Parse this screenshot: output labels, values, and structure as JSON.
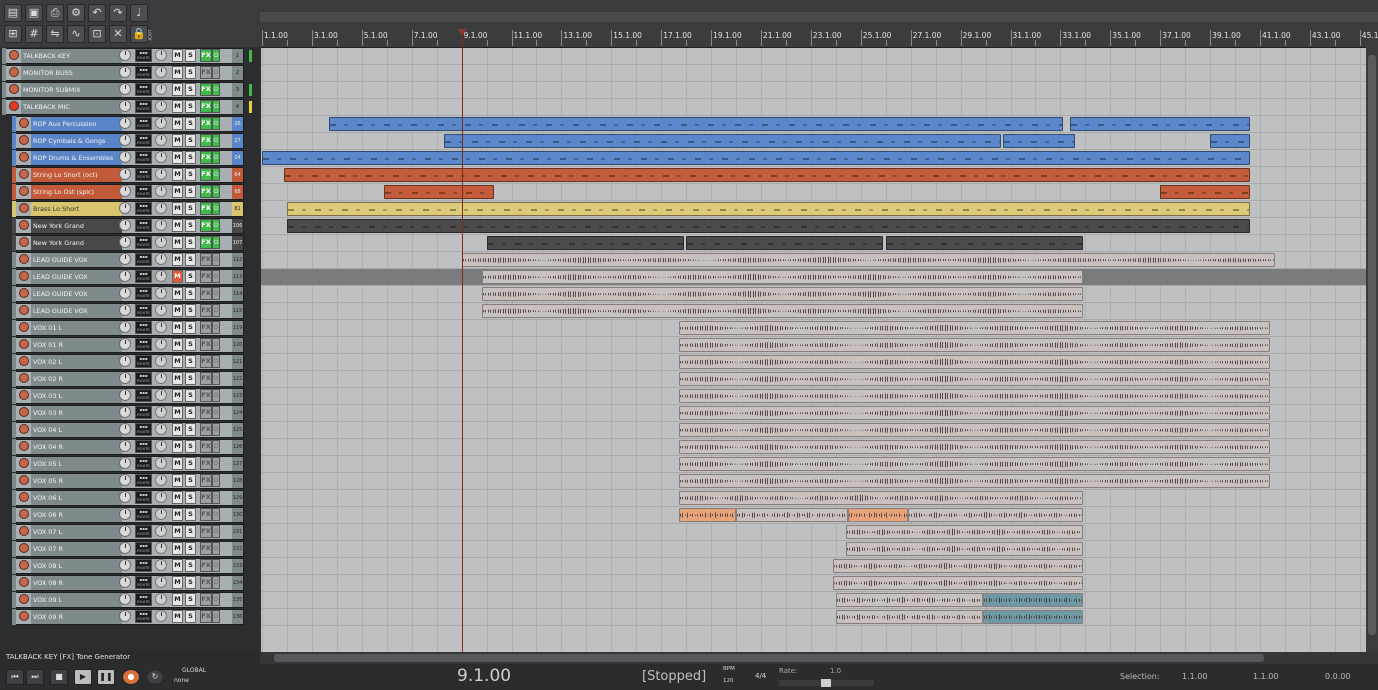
{
  "toolbar": {
    "icons": [
      "new-project-icon",
      "open-project-icon",
      "save-project-icon",
      "project-settings-icon",
      "undo-icon",
      "redo-icon",
      "metronome-icon",
      "snap-icon",
      "grid-icon",
      "ripple-edit-icon",
      "envelope-icon",
      "item-lock-icon",
      "auto-crossfade-icon",
      "lock-icon"
    ],
    "lock_label": "LOCK"
  },
  "tracks": [
    {
      "name": "TALKBACK KEY",
      "num": "1",
      "color": "#7f8a8d",
      "fx": true,
      "muted": false,
      "rec": "orange"
    },
    {
      "name": "MONITOR BUSS",
      "num": "2",
      "color": "#7f8a8d",
      "fx": false,
      "muted": false,
      "rec": "orange"
    },
    {
      "name": "MONITOR SUBMIX",
      "num": "3",
      "color": "#7f8a8d",
      "fx": true,
      "muted": false,
      "rec": "orange"
    },
    {
      "name": "TALKBACK MIC",
      "num": "4",
      "color": "#7f8a8d",
      "fx": true,
      "muted": false,
      "rec": "red"
    },
    {
      "name": "ROP Aux Percussion",
      "num": "26",
      "color": "#5a86c9",
      "fx": true,
      "muted": false,
      "rec": "orange"
    },
    {
      "name": "ROP Cymbals & Gongs",
      "num": "27",
      "color": "#5a86c9",
      "fx": true,
      "muted": false,
      "rec": "orange"
    },
    {
      "name": "ROP Drums & Ensembles",
      "num": "24",
      "color": "#5a86c9",
      "fx": true,
      "muted": false,
      "rec": "orange"
    },
    {
      "name": "String Lo Short (oct)",
      "num": "64",
      "color": "#c25a3a",
      "fx": true,
      "muted": false,
      "rec": "orange"
    },
    {
      "name": "String Lo Ost (spic)",
      "num": "68",
      "color": "#c25a3a",
      "fx": true,
      "muted": false,
      "rec": "orange"
    },
    {
      "name": "Brass Lo Short",
      "num": "81",
      "color": "#d8c56e",
      "fx": true,
      "muted": false,
      "rec": "orange"
    },
    {
      "name": "New York Grand",
      "num": "106",
      "color": "#4a4748",
      "fx": true,
      "muted": false,
      "rec": "orange"
    },
    {
      "name": "New York Grand",
      "num": "107",
      "color": "#4a4748",
      "fx": true,
      "muted": false,
      "rec": "orange"
    },
    {
      "name": "LEAD GUIDE VOX",
      "num": "112",
      "color": "#7f8a8d",
      "fx": false,
      "muted": false,
      "rec": "orange"
    },
    {
      "name": "LEAD GUIDE VOX",
      "num": "113",
      "color": "#7f8a8d",
      "fx": false,
      "muted": true,
      "rec": "orange"
    },
    {
      "name": "LEAD GUIDE VOX",
      "num": "114",
      "color": "#7f8a8d",
      "fx": false,
      "muted": false,
      "rec": "orange"
    },
    {
      "name": "LEAD GUIDE VOX",
      "num": "115",
      "color": "#7f8a8d",
      "fx": false,
      "muted": false,
      "rec": "orange"
    },
    {
      "name": "VOX 01 L",
      "num": "119",
      "color": "#7f8a8d",
      "fx": false,
      "muted": false,
      "rec": "orange"
    },
    {
      "name": "VOX 01 R",
      "num": "120",
      "color": "#7f8a8d",
      "fx": false,
      "muted": false,
      "rec": "orange"
    },
    {
      "name": "VOX 02 L",
      "num": "121",
      "color": "#7f8a8d",
      "fx": false,
      "muted": false,
      "rec": "orange"
    },
    {
      "name": "VOX 02 R",
      "num": "122",
      "color": "#7f8a8d",
      "fx": false,
      "muted": false,
      "rec": "orange"
    },
    {
      "name": "VOX 03 L",
      "num": "123",
      "color": "#7f8a8d",
      "fx": false,
      "muted": false,
      "rec": "orange"
    },
    {
      "name": "VOX 03 R",
      "num": "124",
      "color": "#7f8a8d",
      "fx": false,
      "muted": false,
      "rec": "orange"
    },
    {
      "name": "VOX 04 L",
      "num": "125",
      "color": "#7f8a8d",
      "fx": false,
      "muted": false,
      "rec": "orange"
    },
    {
      "name": "VOX 04 R",
      "num": "126",
      "color": "#7f8a8d",
      "fx": false,
      "muted": false,
      "rec": "orange"
    },
    {
      "name": "VOX 05 L",
      "num": "127",
      "color": "#7f8a8d",
      "fx": false,
      "muted": false,
      "rec": "orange"
    },
    {
      "name": "VOX 05 R",
      "num": "128",
      "color": "#7f8a8d",
      "fx": false,
      "muted": false,
      "rec": "orange"
    },
    {
      "name": "VOX 06 L",
      "num": "129",
      "color": "#7f8a8d",
      "fx": false,
      "muted": false,
      "rec": "orange"
    },
    {
      "name": "VOX 06 R",
      "num": "130",
      "color": "#7f8a8d",
      "fx": false,
      "muted": false,
      "rec": "orange"
    },
    {
      "name": "VOX 07 L",
      "num": "131",
      "color": "#7f8a8d",
      "fx": false,
      "muted": false,
      "rec": "orange"
    },
    {
      "name": "VOX 07 R",
      "num": "132",
      "color": "#7f8a8d",
      "fx": false,
      "muted": false,
      "rec": "orange"
    },
    {
      "name": "VOX 08 L",
      "num": "133",
      "color": "#7f8a8d",
      "fx": false,
      "muted": false,
      "rec": "orange"
    },
    {
      "name": "VOX 08 R",
      "num": "134",
      "color": "#7f8a8d",
      "fx": false,
      "muted": false,
      "rec": "orange"
    },
    {
      "name": "VOX 09 L",
      "num": "135",
      "color": "#7f8a8d",
      "fx": false,
      "muted": false,
      "rec": "orange"
    },
    {
      "name": "VOX 09 R",
      "num": "136",
      "color": "#7f8a8d",
      "fx": false,
      "muted": false,
      "rec": "orange"
    }
  ],
  "track_button_labels": {
    "mute": "M",
    "solo": "S",
    "fx": "FX",
    "route": "ROUTE",
    "power": "⏻"
  },
  "ruler": {
    "labels": [
      "1.1.00",
      "3.1.00",
      "5.1.00",
      "7.1.00",
      "9.1.00",
      "11.1.00",
      "13.1.00",
      "15.1.00",
      "17.1.00",
      "19.1.00",
      "21.1.00",
      "23.1.00",
      "25.1.00",
      "27.1.00",
      "29.1.00",
      "31.1.00",
      "33.1.00",
      "35.1.00",
      "37.1.00",
      "39.1.00",
      "41.1.00",
      "43.1.00",
      "45.1"
    ]
  },
  "items": [
    {
      "track": 4,
      "start": 3.7,
      "end": 33.1,
      "kind": "midi",
      "color": "#5b87cb"
    },
    {
      "track": 4,
      "start": 33.4,
      "end": 40.6,
      "kind": "midi",
      "color": "#5b87cb"
    },
    {
      "track": 5,
      "start": 8.3,
      "end": 30.6,
      "kind": "midi",
      "color": "#5b87cb"
    },
    {
      "track": 5,
      "start": 30.7,
      "end": 33.6,
      "kind": "midi",
      "color": "#5b87cb"
    },
    {
      "track": 5,
      "start": 39.0,
      "end": 40.6,
      "kind": "midi",
      "color": "#5b87cb"
    },
    {
      "track": 6,
      "start": 1.0,
      "end": 40.6,
      "kind": "midi",
      "color": "#5b87cb"
    },
    {
      "track": 7,
      "start": 1.9,
      "end": 40.6,
      "kind": "midi",
      "color": "#c35d3c"
    },
    {
      "track": 8,
      "start": 5.9,
      "end": 10.3,
      "kind": "midi",
      "color": "#c35d3c"
    },
    {
      "track": 8,
      "start": 37.0,
      "end": 40.6,
      "kind": "midi",
      "color": "#c35d3c"
    },
    {
      "track": 9,
      "start": 2.0,
      "end": 40.6,
      "kind": "midi",
      "color": "#dcca79"
    },
    {
      "track": 10,
      "start": 2.0,
      "end": 40.6,
      "kind": "midi",
      "color": "#4d4a4b"
    },
    {
      "track": 11,
      "start": 10.0,
      "end": 17.9,
      "kind": "midi",
      "color": "#4d4a4b"
    },
    {
      "track": 11,
      "start": 18.0,
      "end": 25.9,
      "kind": "midi",
      "color": "#4d4a4b"
    },
    {
      "track": 11,
      "start": 26.0,
      "end": 33.9,
      "kind": "midi",
      "color": "#4d4a4b"
    },
    {
      "track": 12,
      "start": 9.0,
      "end": 41.6,
      "kind": "audio",
      "color": "#c7c2c0"
    },
    {
      "track": 13,
      "start": 9.8,
      "end": 33.9,
      "kind": "audio",
      "color": "#c7c2c0"
    },
    {
      "track": 14,
      "start": 9.8,
      "end": 33.9,
      "kind": "audio",
      "color": "#c7c2c0"
    },
    {
      "track": 15,
      "start": 9.8,
      "end": 33.9,
      "kind": "audio",
      "color": "#c7c2c0"
    },
    {
      "track": 16,
      "start": 17.7,
      "end": 41.4,
      "kind": "audio",
      "color": "#c7c2c0"
    },
    {
      "track": 17,
      "start": 17.7,
      "end": 41.4,
      "kind": "audio",
      "color": "#c7c2c0"
    },
    {
      "track": 18,
      "start": 17.7,
      "end": 41.4,
      "kind": "audio",
      "color": "#c7c2c0"
    },
    {
      "track": 19,
      "start": 17.7,
      "end": 41.4,
      "kind": "audio",
      "color": "#c7c2c0"
    },
    {
      "track": 20,
      "start": 17.7,
      "end": 41.4,
      "kind": "audio",
      "color": "#c7c2c0"
    },
    {
      "track": 21,
      "start": 17.7,
      "end": 41.4,
      "kind": "audio",
      "color": "#c7c2c0"
    },
    {
      "track": 22,
      "start": 17.7,
      "end": 41.4,
      "kind": "audio",
      "color": "#c7c2c0"
    },
    {
      "track": 23,
      "start": 17.7,
      "end": 41.4,
      "kind": "audio",
      "color": "#c7c2c0"
    },
    {
      "track": 24,
      "start": 17.7,
      "end": 41.4,
      "kind": "audio",
      "color": "#c7c2c0"
    },
    {
      "track": 25,
      "start": 17.7,
      "end": 41.4,
      "kind": "audio",
      "color": "#c7c2c0"
    },
    {
      "track": 26,
      "start": 17.7,
      "end": 33.9,
      "kind": "audio",
      "color": "#c7c2c0"
    },
    {
      "track": 27,
      "start": 17.7,
      "end": 20.0,
      "kind": "audio",
      "color": "#e8a37a"
    },
    {
      "track": 27,
      "start": 20.0,
      "end": 24.5,
      "kind": "audio",
      "color": "#c7c2c0"
    },
    {
      "track": 27,
      "start": 24.5,
      "end": 26.9,
      "kind": "audio",
      "color": "#e8a37a"
    },
    {
      "track": 27,
      "start": 26.9,
      "end": 33.9,
      "kind": "audio",
      "color": "#c7c2c0"
    },
    {
      "track": 28,
      "start": 24.4,
      "end": 33.9,
      "kind": "audio",
      "color": "#c7c2c0"
    },
    {
      "track": 29,
      "start": 24.4,
      "end": 33.9,
      "kind": "audio",
      "color": "#c7c2c0"
    },
    {
      "track": 30,
      "start": 23.9,
      "end": 33.9,
      "kind": "audio",
      "color": "#c7c2c0"
    },
    {
      "track": 31,
      "start": 23.9,
      "end": 33.9,
      "kind": "audio",
      "color": "#c7c2c0"
    },
    {
      "track": 32,
      "start": 24.0,
      "end": 29.9,
      "kind": "audio",
      "color": "#c7c2c0"
    },
    {
      "track": 32,
      "start": 29.9,
      "end": 33.9,
      "kind": "audio",
      "color": "#6e9aa6"
    },
    {
      "track": 33,
      "start": 24.0,
      "end": 29.9,
      "kind": "audio",
      "color": "#c7c2c0"
    },
    {
      "track": 33,
      "start": 29.9,
      "end": 33.9,
      "kind": "audio",
      "color": "#6e9aa6"
    }
  ],
  "playhead_bar": 9.0,
  "selected_track": 13,
  "status_text": "TALKBACK KEY [FX] Tone Generator",
  "transport": {
    "position": "9.1.00",
    "state": "[Stopped]",
    "bpm_label": "BPM",
    "bpm": "120",
    "time_signature": "4/4",
    "rate_label": "Rate:",
    "rate": "1.0",
    "global_label": "GLOBAL",
    "global_value": "none",
    "selection_label": "Selection:",
    "selection_start": "1.1.00",
    "selection_end": "1.1.00",
    "selection_length": "0.0.00"
  }
}
